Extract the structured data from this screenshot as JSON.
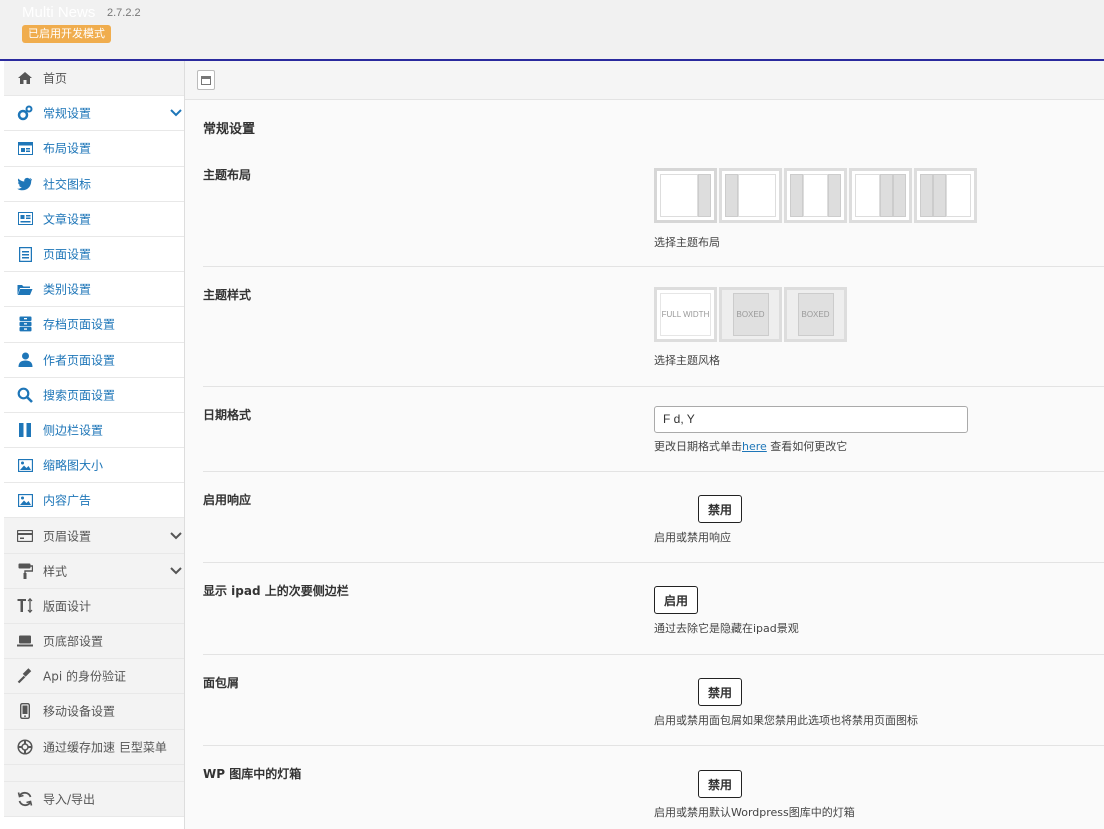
{
  "header": {
    "title": "Multi News",
    "version": "2.7.2.2",
    "dev_badge": "已启用开发模式"
  },
  "sidebar": {
    "items": [
      {
        "label": "首页",
        "icon": "home-icon"
      },
      {
        "label": "常规设置",
        "icon": "gears-icon"
      },
      {
        "label": "布局设置",
        "icon": "layout-icon"
      },
      {
        "label": "社交图标",
        "icon": "twitter-icon"
      },
      {
        "label": "文章设置",
        "icon": "article-icon"
      },
      {
        "label": "页面设置",
        "icon": "page-icon"
      },
      {
        "label": "类别设置",
        "icon": "folder-icon"
      },
      {
        "label": "存档页面设置",
        "icon": "archive-icon"
      },
      {
        "label": "作者页面设置",
        "icon": "user-icon"
      },
      {
        "label": "搜索页面设置",
        "icon": "search-icon"
      },
      {
        "label": "侧边栏设置",
        "icon": "columns-icon"
      },
      {
        "label": "缩略图大小",
        "icon": "image-icon"
      },
      {
        "label": "内容广告",
        "icon": "image-icon"
      },
      {
        "label": "页眉设置",
        "icon": "card-icon"
      },
      {
        "label": "样式",
        "icon": "paint-roller-icon"
      },
      {
        "label": "版面设计",
        "icon": "text-height-icon"
      },
      {
        "label": "页底部设置",
        "icon": "laptop-icon"
      },
      {
        "label": "Api 的身份验证",
        "icon": "gavel-icon"
      },
      {
        "label": "移动设备设置",
        "icon": "mobile-icon"
      },
      {
        "label": "通过缓存加速 巨型菜单",
        "icon": "lifebuoy-icon"
      },
      {
        "label": "导入/导出",
        "icon": "refresh-icon"
      }
    ]
  },
  "main": {
    "title": "常规设置",
    "layout": {
      "title": "主题布局",
      "desc": "选择主题布局"
    },
    "style": {
      "title": "主题样式",
      "desc": "选择主题风格",
      "options": [
        "FULL WIDTH",
        "BOXED",
        "BOXED"
      ]
    },
    "date": {
      "title": "日期格式",
      "value": "F d, Y",
      "desc_pre": "更改日期格式单击",
      "link": "here",
      "desc_post": " 查看如何更改它"
    },
    "responsive": {
      "title": "启用响应",
      "state_label": "禁用",
      "desc": "启用或禁用响应"
    },
    "ipad": {
      "title": "显示 ipad 上的次要侧边栏",
      "state_label": "启用",
      "desc": "通过去除它是隐藏在ipad景观"
    },
    "breadcrumb": {
      "title": "面包屑",
      "state_label": "禁用",
      "desc": "启用或禁用面包屑如果您禁用此选项也将禁用页面图标"
    },
    "lightbox": {
      "title": "WP 图库中的灯箱",
      "state_label": "禁用",
      "desc": "启用或禁用默认Wordpress图库中的灯箱"
    }
  },
  "colors": {
    "accent": "#1e76b8",
    "badge": "#f0ad4e",
    "header_border": "#2a2a9e"
  }
}
